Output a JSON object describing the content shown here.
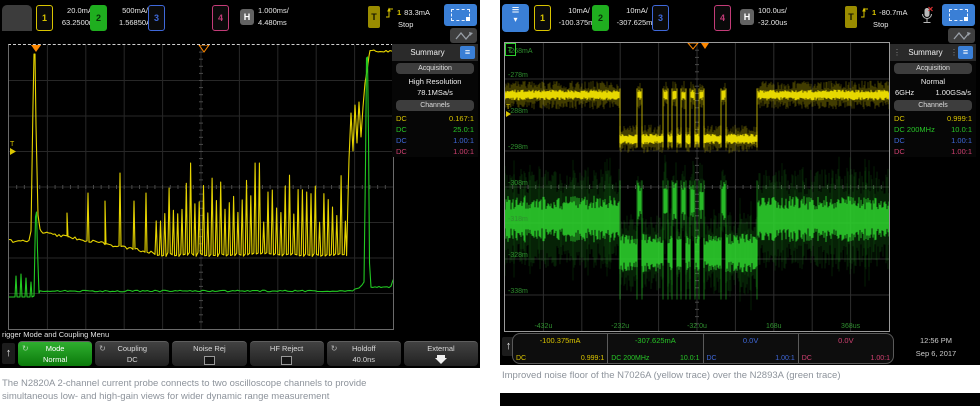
{
  "colors": {
    "ch1": "#d9c400",
    "ch2": "#27c527",
    "ch3": "#3f68d9",
    "ch4": "#cf4070",
    "accent_blue": "#3a7fd6",
    "trigger_orange": "#ff8800"
  },
  "icons": {
    "menu": "≡",
    "up_arrow": "↑",
    "rotary": "↻",
    "down_triangle": "▾",
    "grip": "⋮"
  },
  "left": {
    "top": {
      "ch1_num": "1",
      "ch1_scale": "20.0mA/",
      "ch1_offset": "63.2500mA",
      "ch2_num": "2",
      "ch2_scale": "500mA/",
      "ch2_offset": "1.56850A",
      "ch3_num": "3",
      "ch4_num": "4",
      "h_label": "H",
      "h_scale": "1.000ms/",
      "h_delay": "4.480ms",
      "t_label": "T",
      "trig_source": "1",
      "trig_level": "83.3mA",
      "run_state": "Stop"
    },
    "sidebar": {
      "title": "Summary",
      "acq_header": "Acquisition",
      "acq_mode": "High Resolution",
      "sample_rate": "78.1MSa/s",
      "ch_header": "Channels",
      "rows": [
        {
          "coupling": "DC",
          "ratio": "0.167:1"
        },
        {
          "coupling": "DC",
          "ratio": "25.0:1"
        },
        {
          "coupling": "DC",
          "ratio": "1.00:1"
        },
        {
          "coupling": "DC",
          "ratio": "1.00:1"
        }
      ]
    },
    "status_line": "rigger Mode and Coupling Menu",
    "softkeys": [
      {
        "label": "Mode",
        "value": "Normal"
      },
      {
        "label": "Coupling",
        "value": "DC"
      },
      {
        "label": "Noise Rej",
        "value": ""
      },
      {
        "label": "HF Reject",
        "value": ""
      },
      {
        "label": "Holdoff",
        "value": "40.0ns"
      },
      {
        "label": "External",
        "value": ""
      }
    ],
    "caption_line1": "The N2820A 2-channel current probe connects to two oscilloscope channels to provide",
    "caption_line2": "simultaneous low- and high-gain views for wider dynamic range measurement"
  },
  "right": {
    "top": {
      "ch1_num": "1",
      "ch1_scale": "10mA/",
      "ch1_offset": "-100.375mA",
      "ch2_num": "2",
      "ch2_scale": "10mA/",
      "ch2_offset": "-307.625mA",
      "ch3_num": "3",
      "ch4_num": "4",
      "h_label": "H",
      "h_scale": "100.0us/",
      "h_delay": "-32.00us",
      "t_label": "T",
      "trig_source": "1",
      "trig_level": "-80.7mA",
      "run_state": "Stop"
    },
    "sidebar": {
      "title": "Summary",
      "acq_header": "Acquisition",
      "acq_mode": "Normal",
      "bandwidth": "6GHz",
      "sample_rate": "1.00GSa/s",
      "ch_header": "Channels",
      "rows": [
        {
          "coupling": "DC",
          "ratio": "0.999:1"
        },
        {
          "coupling": "DC 200MHz",
          "ratio": "10.0:1"
        },
        {
          "coupling": "DC",
          "ratio": "1.00:1"
        },
        {
          "coupling": "DC",
          "ratio": "1.00:1"
        }
      ]
    },
    "graticule": {
      "y_labels": [
        "-268mA",
        "-278m",
        "-288m",
        "-298m",
        "-308m",
        "-318m",
        "-328m",
        "-338m"
      ],
      "x_labels": [
        "-432u",
        "-232u",
        "-32.0u",
        "168u",
        "368us"
      ]
    },
    "bottom": {
      "channels": [
        {
          "value": "-100.375mA",
          "coupling": "DC",
          "ratio": "0.999:1"
        },
        {
          "value": "-307.625mA",
          "coupling": "DC 200MHz",
          "ratio": "10.0:1"
        },
        {
          "value": "0.0V",
          "coupling": "DC",
          "ratio": "1.00:1"
        },
        {
          "value": "0.0V",
          "coupling": "DC",
          "ratio": "1.00:1"
        }
      ],
      "time": "12:56 PM",
      "date": "Sep 6, 2017"
    },
    "caption": "Improved noise floor of the N7026A (yellow trace) over the N2893A (green trace)"
  }
}
